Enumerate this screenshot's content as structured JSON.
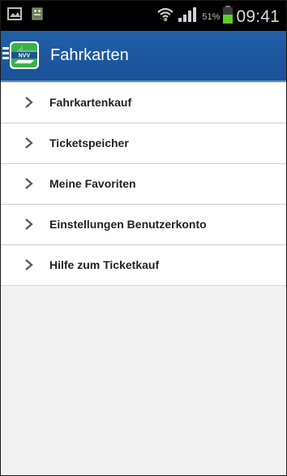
{
  "status_bar": {
    "battery_percent": "51%",
    "time": "09:41",
    "icons": [
      "gallery-icon",
      "notification-icon",
      "wifi-icon",
      "signal-icon",
      "battery-icon"
    ]
  },
  "app_bar": {
    "title": "Fahrkarten",
    "logo_text": "NVV",
    "brand_color": "#1b5297",
    "logo_green": "#3bb14a"
  },
  "menu": {
    "items": [
      {
        "label": "Fahrkartenkauf",
        "icon": "chevron-right-icon"
      },
      {
        "label": "Ticketspeicher",
        "icon": "chevron-right-icon"
      },
      {
        "label": "Meine Favoriten",
        "icon": "chevron-right-icon"
      },
      {
        "label": "Einstellungen Benutzerkonto",
        "icon": "chevron-right-icon"
      },
      {
        "label": "Hilfe zum Ticketkauf",
        "icon": "chevron-right-icon"
      }
    ]
  }
}
